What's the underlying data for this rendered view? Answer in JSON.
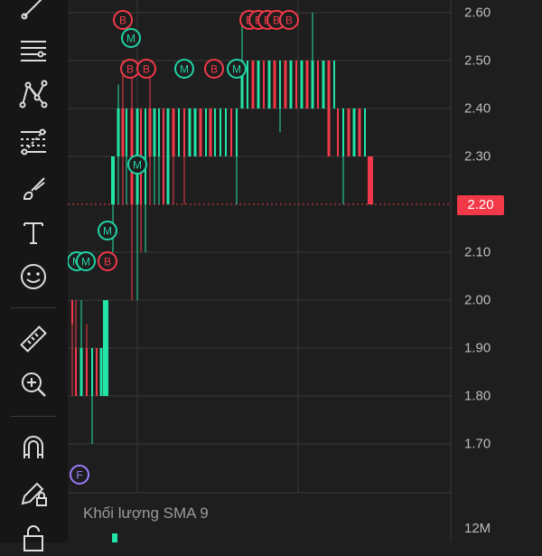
{
  "toolbar": {
    "tools": [
      {
        "name": "trend-line-tool",
        "icon": "line-icon"
      },
      {
        "name": "horizontal-lines-tool",
        "icon": "lines-icon"
      },
      {
        "name": "pattern-tool",
        "icon": "pattern-icon"
      },
      {
        "name": "fib-tool",
        "icon": "fib-icon"
      },
      {
        "name": "brush-tool",
        "icon": "brush-icon"
      },
      {
        "name": "text-tool",
        "icon": "text-icon"
      },
      {
        "name": "emoji-tool",
        "icon": "smiley-icon"
      },
      {
        "name": "ruler-tool",
        "icon": "ruler-icon"
      },
      {
        "name": "zoom-tool",
        "icon": "zoom-in-icon"
      },
      {
        "name": "magnet-tool",
        "icon": "magnet-icon"
      },
      {
        "name": "lock-drawing-tool",
        "icon": "pencil-lock-icon"
      },
      {
        "name": "lock-tool",
        "icon": "lock-icon"
      }
    ]
  },
  "price_axis": {
    "ticks": [
      "2.60",
      "2.50",
      "2.40",
      "2.30",
      "2.20",
      "2.10",
      "2.00",
      "1.90",
      "1.80",
      "1.70"
    ],
    "current_price": "2.20",
    "current_price_color": "#f2394a"
  },
  "volume_pane": {
    "label": "Khối lượng SMA 9",
    "tick": "12M"
  },
  "markers": {
    "buy_letter": "B",
    "m_letter": "M",
    "f_letter": "F",
    "buy_color": "#f2394a",
    "m_color": "#22d3a6",
    "f_color": "#9b7bff"
  },
  "colors": {
    "up": "#22e4a6",
    "down": "#f2394a",
    "grid": "#3a3a3a"
  }
}
